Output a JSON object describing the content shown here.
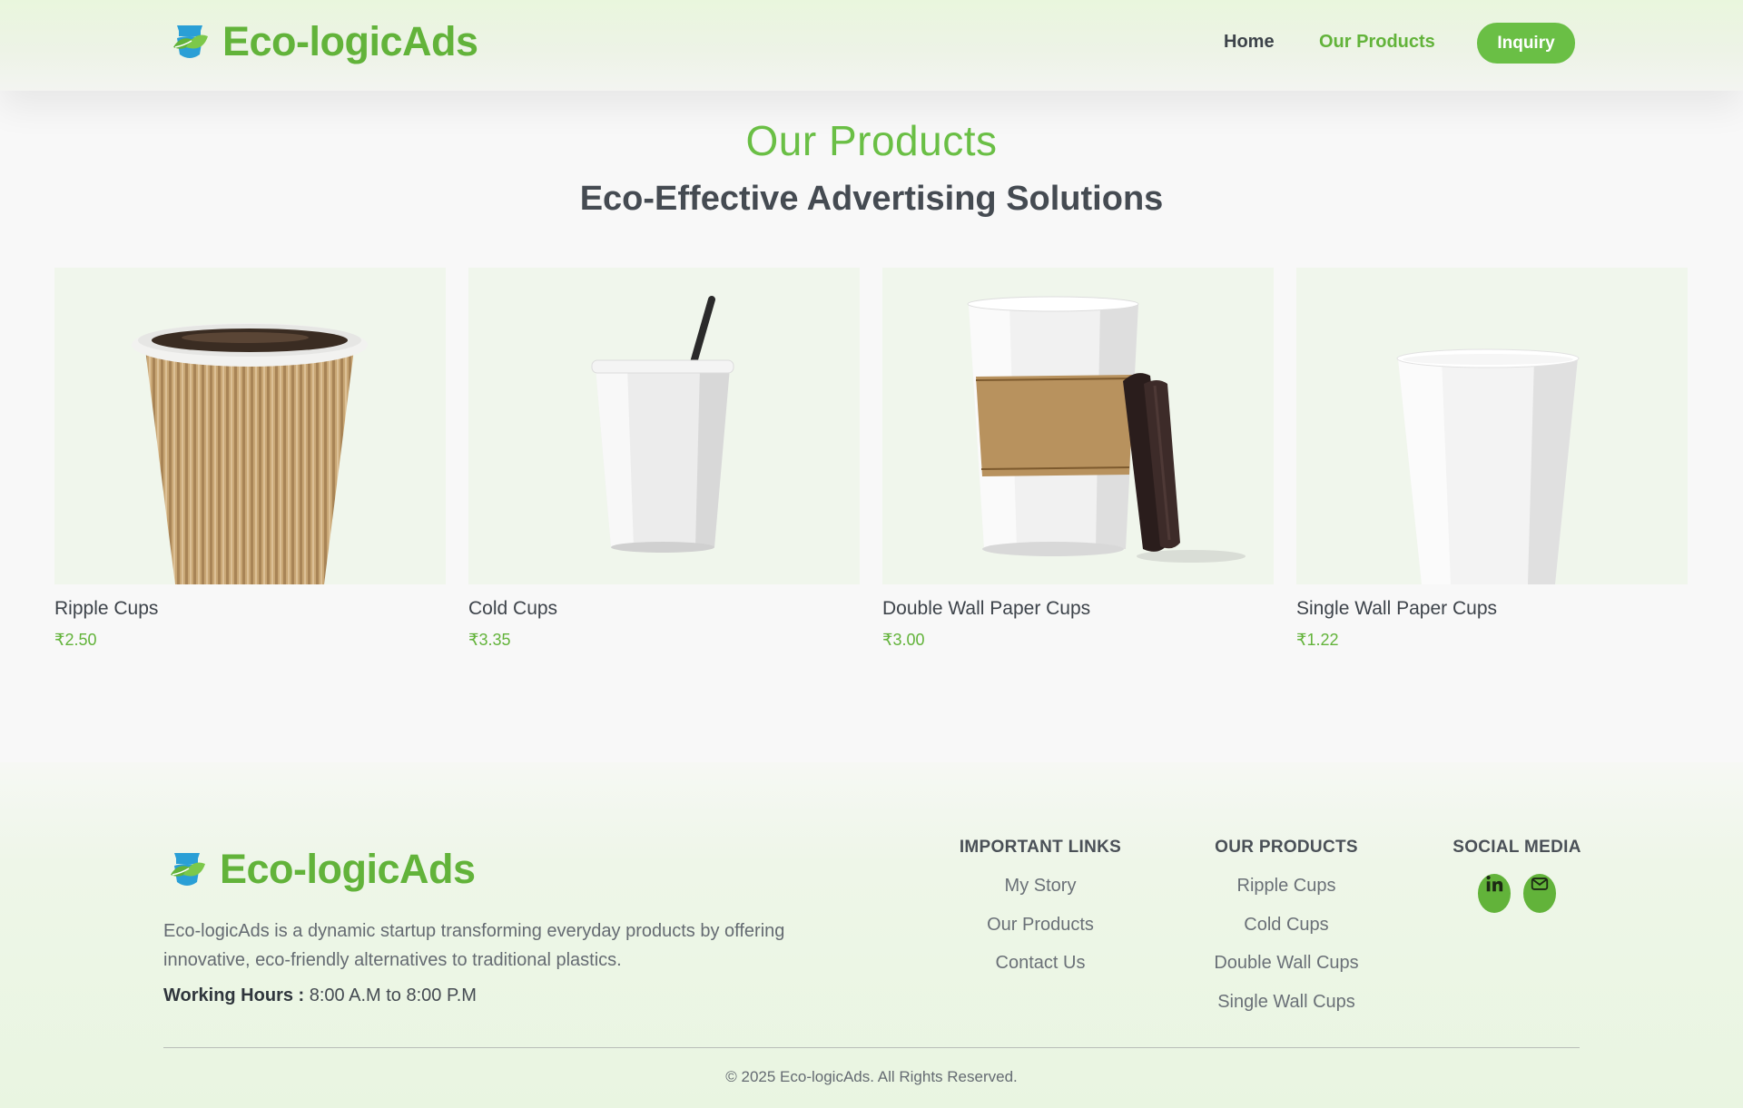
{
  "colors": {
    "brand_green": "#62b33a",
    "button_green": "#6abf45",
    "text_dark": "#454b52",
    "card_bg": "#f0f6ec"
  },
  "header": {
    "logo_icon": "cup-with-leaves-icon",
    "brand": "Eco-logicAds",
    "nav": {
      "home": "Home",
      "products": "Our Products",
      "inquiry": "Inquiry"
    }
  },
  "intro": {
    "title": "Our Products",
    "subtitle": "Eco-Effective Advertising Solutions"
  },
  "products": [
    {
      "name": "Ripple Cups",
      "price": "₹2.50",
      "image": "ripple-cup-image"
    },
    {
      "name": "Cold Cups",
      "price": "₹3.35",
      "image": "cold-cup-image"
    },
    {
      "name": "Double Wall Paper Cups",
      "price": "₹3.00",
      "image": "double-wall-cup-image"
    },
    {
      "name": "Single Wall Paper Cups",
      "price": "₹1.22",
      "image": "single-wall-cup-image"
    }
  ],
  "footer": {
    "brand": "Eco-logicAds",
    "description": "Eco-logicAds is a dynamic startup transforming everyday products by offering innovative, eco-friendly alternatives to traditional plastics.",
    "hours_label": "Working Hours :",
    "hours_value": "8:00 A.M to 8:00 P.M",
    "important_links": {
      "heading": "IMPORTANT LINKS",
      "items": [
        "My Story",
        "Our Products",
        "Contact Us"
      ]
    },
    "our_products": {
      "heading": "OUR PRODUCTS",
      "items": [
        "Ripple Cups",
        "Cold Cups",
        "Double Wall Cups",
        "Single Wall Cups"
      ]
    },
    "social": {
      "heading": "SOCIAL MEDIA",
      "icons": [
        "linkedin-icon",
        "email-icon"
      ]
    },
    "copyright": "© 2025 Eco-logicAds. All Rights Reserved."
  }
}
